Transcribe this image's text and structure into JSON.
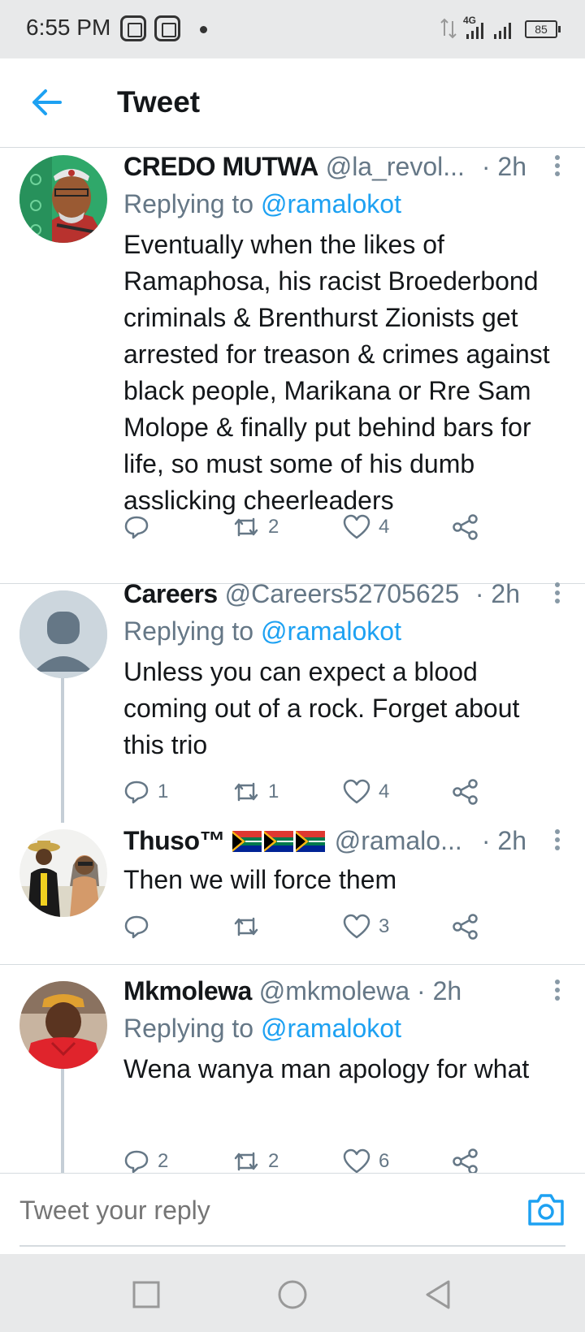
{
  "status_bar": {
    "time": "6:55 PM",
    "network": "4G",
    "battery": "85"
  },
  "header": {
    "title": "Tweet",
    "back_icon": "arrow-left-icon",
    "accent_color": "#1da1f2"
  },
  "tweets": [
    {
      "name": "CREDO MUTWA",
      "handle": "@la_revol...",
      "time": "· 2h",
      "replying_label": "Replying to",
      "replying_to": "@ramalokot",
      "text": "Eventually when the likes of Ramaphosa, his racist Broederbond criminals & Brenthurst Zionists get arrested for treason & crimes against black people, Marikana or Rre Sam Molope & finally put behind bars for life, so must some of his dumb asslicking cheerleaders",
      "replies": "",
      "retweets": "2",
      "likes": "4"
    },
    {
      "name": "Careers",
      "handle": "@Careers52705625",
      "time": "· 2h",
      "replying_label": "Replying to",
      "replying_to": "@ramalokot",
      "text": "Unless you can expect a blood coming out of a rock. Forget about this trio",
      "replies": "1",
      "retweets": "1",
      "likes": "4"
    },
    {
      "name": "Thuso™",
      "handle": "@ramalo...",
      "time": "· 2h",
      "text": "Then we will force them",
      "replies": "",
      "retweets": "",
      "likes": "3"
    },
    {
      "name": "Mkmolewa",
      "handle": "@mkmolewa",
      "time": "· 2h",
      "replying_label": "Replying to",
      "replying_to": "@ramalokot",
      "text": "Wena wanya man apology for what",
      "replies": "2",
      "retweets": "2",
      "likes": "6"
    }
  ],
  "reply_bar": {
    "placeholder": "Tweet your reply",
    "camera_icon": "camera-icon"
  },
  "nav": {
    "icons": [
      "recents-square-icon",
      "home-circle-icon",
      "back-triangle-icon"
    ]
  }
}
